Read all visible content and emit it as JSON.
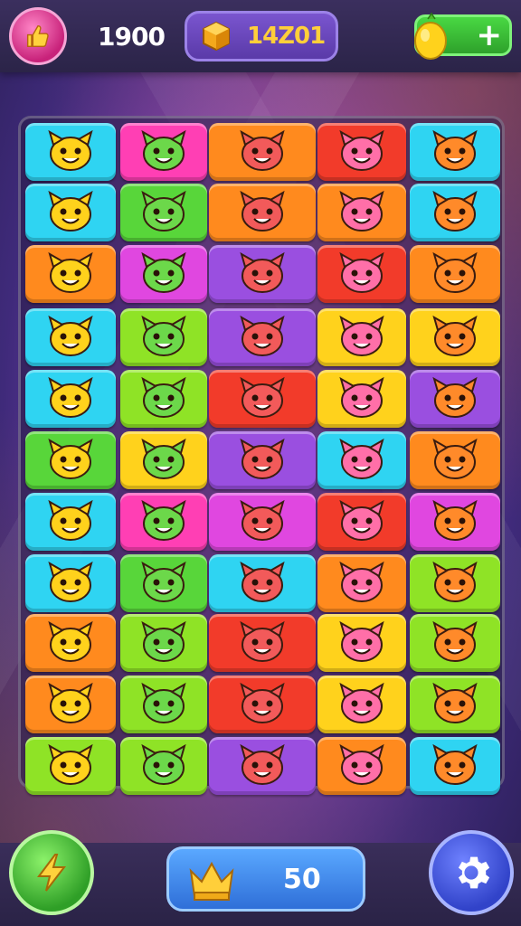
{
  "header": {
    "score": "1900",
    "gold": "14Z01",
    "like_icon": "thumbs-up-icon",
    "gold_icon": "gold-cube-icon",
    "energy_icon": "lemon-icon",
    "add_label": "+"
  },
  "board": {
    "rows": 11,
    "cols": 5,
    "colors": {
      "cyan": "#2fd4f2",
      "pink": "#ff3fb4",
      "orange": "#ff8a1e",
      "red": "#f23b2a",
      "yellow": "#ffd21c",
      "green": "#58d63a",
      "purple": "#9a4fe0",
      "magenta": "#e047e0",
      "lime": "#8fe326"
    }
  },
  "footer": {
    "crown_count": "50",
    "power_icon": "lightning-icon",
    "crown_icon": "crown-icon",
    "settings_icon": "gear-icon"
  }
}
